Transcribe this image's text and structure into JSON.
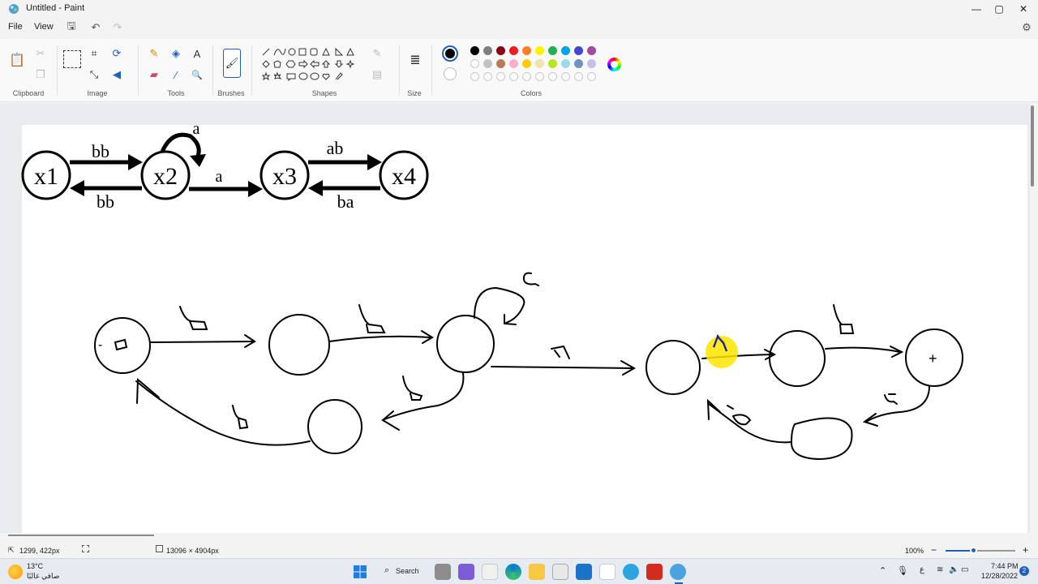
{
  "window": {
    "title": "Untitled - Paint",
    "min_icon": "minimize-icon",
    "max_icon": "maximize-icon",
    "close_icon": "close-icon"
  },
  "menu": {
    "file": "File",
    "view": "View"
  },
  "ribbon": {
    "groups": {
      "clipboard": "Clipboard",
      "image": "Image",
      "tools": "Tools",
      "brushes": "Brushes",
      "shapes": "Shapes",
      "size": "Size",
      "colors": "Colors"
    },
    "tool_icons": {
      "text": "A",
      "magnifier": "🔍"
    }
  },
  "colors": {
    "primary": "#000000",
    "secondary": "#ffffff",
    "row1": [
      "#000000",
      "#7f7f7f",
      "#880015",
      "#ed1c24",
      "#ff7f27",
      "#fff200",
      "#22b14c",
      "#00a2e8",
      "#3f48cc",
      "#a349a4"
    ],
    "row2": [
      "#ffffff",
      "#c3c3c3",
      "#b97a57",
      "#ffaec9",
      "#ffc90e",
      "#efe4b0",
      "#b5e61d",
      "#99d9ea",
      "#7092be",
      "#c8bfe7"
    ]
  },
  "diagram": {
    "states": [
      "x1",
      "x2",
      "x3",
      "x4"
    ],
    "edge_labels": {
      "x1_x2": "bb",
      "x2_x1": "bb",
      "x2_self": "a",
      "x2_x3": "a",
      "x3_x4": "ab",
      "x4_x3": "ba"
    }
  },
  "handwriting": {
    "start_mark": "-",
    "final_mark": "+"
  },
  "status": {
    "cursor": "1299, 422px",
    "dimensions": "13096 × 4904px",
    "zoom": "100%"
  },
  "taskbar": {
    "weather_temp": "13°C",
    "weather_desc": "صافي غالبًا",
    "search": "Search",
    "time": "7:44 PM",
    "date": "12/28/2022",
    "lang": "ع",
    "notif_count": "2"
  }
}
